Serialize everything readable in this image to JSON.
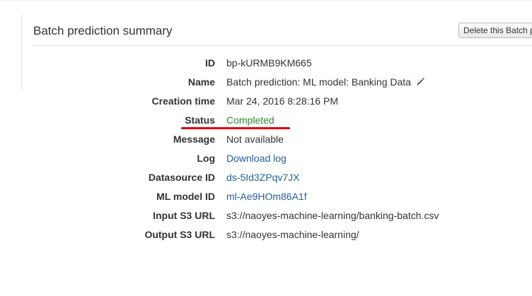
{
  "panel": {
    "title": "Batch prediction summary",
    "delete_button_label": "Delete this Batch prediction"
  },
  "details": {
    "id": {
      "label": "ID",
      "value": "bp-kURMB9KM665"
    },
    "name": {
      "label": "Name",
      "value": "Batch prediction: ML model: Banking Data"
    },
    "creation_time": {
      "label": "Creation time",
      "value": "Mar 24, 2016 8:28:16 PM"
    },
    "status": {
      "label": "Status",
      "value": "Completed"
    },
    "message": {
      "label": "Message",
      "value": "Not available"
    },
    "log": {
      "label": "Log",
      "value": "Download log"
    },
    "datasource_id": {
      "label": "Datasource ID",
      "value": "ds-5Id3ZPqv7JX"
    },
    "ml_model_id": {
      "label": "ML model ID",
      "value": "ml-Ae9HOm86A1f"
    },
    "input_s3_url": {
      "label": "Input S3 URL",
      "value": "s3://naoyes-machine-learning/banking-batch.csv"
    },
    "output_s3_url": {
      "label": "Output S3 URL",
      "value": "s3://naoyes-machine-learning/"
    }
  },
  "icons": {
    "edit_name": "pencil-icon"
  },
  "colors": {
    "link": "#1f5fa8",
    "status_completed": "#2d8a2d",
    "annotation_underline": "#e00000"
  }
}
